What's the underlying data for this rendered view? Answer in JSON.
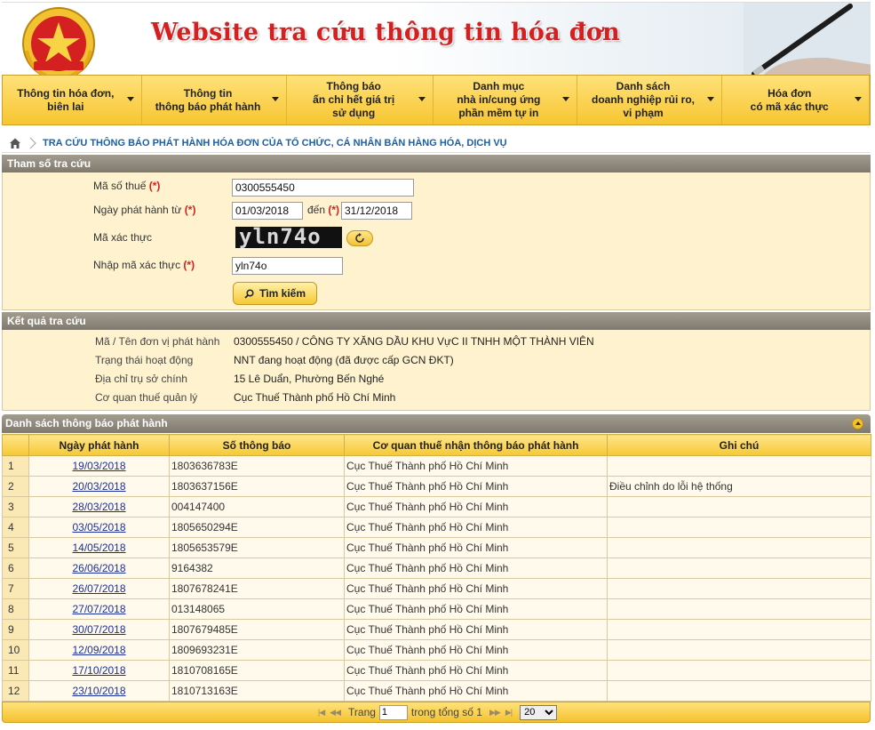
{
  "header": {
    "site_title": "Website tra cứu thông tin hóa đơn",
    "logo_text": "THUẾ NHÀ NƯỚC"
  },
  "menu": [
    {
      "label": "Thông tin hóa đơn,\nbiên lai",
      "width": 157
    },
    {
      "label": "Thông tin\nthông báo phát hành",
      "width": 164
    },
    {
      "label": "Thông báo\nấn chỉ hết giá trị\nsử dụng",
      "width": 165
    },
    {
      "label": "Danh mục\nnhà in/cung ứng\nphần mềm tự in",
      "width": 162
    },
    {
      "label": "Danh sách\ndoanh nghiệp rủi ro,\nvi phạm",
      "width": 164
    },
    {
      "label": "Hóa đơn\ncó mã xác thực",
      "width": 166
    }
  ],
  "breadcrumb": {
    "text": "TRA CỨU THÔNG BÁO PHÁT HÀNH HÓA ĐƠN CỦA TỔ CHỨC, CÁ NHÂN BÁN HÀNG HÓA, DỊCH VỤ"
  },
  "search": {
    "title": "Tham số tra cứu",
    "tax_code_label": "Mã số thuế",
    "tax_code_value": "0300555450",
    "date_label": "Ngày phát hành từ",
    "date_from": "01/03/2018",
    "to_label": "đến",
    "date_to": "31/12/2018",
    "captcha_label": "Mã xác thực",
    "captcha_text": "yln74o",
    "captcha_input_label": "Nhập mã xác thực",
    "captcha_input_value": "yln74o",
    "required_mark": "(*)",
    "search_button": "Tìm kiếm"
  },
  "result": {
    "title": "Kết quả tra cứu",
    "rows": [
      {
        "k": "Mã / Tên đơn vị phát hành",
        "v": "0300555450 / CÔNG TY XĂNG DẦU KHU VựC II TNHH MỘT THÀNH VIÊN"
      },
      {
        "k": "Trạng thái hoạt động",
        "v": "NNT đang hoạt động (đã được cấp GCN ĐKT)"
      },
      {
        "k": "Địa chỉ trụ sở chính",
        "v": "15 Lê Duẩn, Phường Bến Nghé"
      },
      {
        "k": "Cơ quan thuế quản lý",
        "v": "Cục Thuế Thành phố Hồ Chí Minh"
      }
    ]
  },
  "list": {
    "title": "Danh sách thông báo phát hành",
    "columns": [
      "",
      "Ngày phát hành",
      "Số thông báo",
      "Cơ quan thuế nhận thông báo phát hành",
      "Ghi chú"
    ],
    "rows": [
      {
        "idx": "1",
        "date": "19/03/2018",
        "num": "1803636783E",
        "office": "Cục Thuế Thành phố Hồ Chí Minh",
        "note": ""
      },
      {
        "idx": "2",
        "date": "20/03/2018",
        "num": "1803637156E",
        "office": "Cục Thuế Thành phố Hồ Chí Minh",
        "note": "Điều chỉnh do lỗi hệ thống"
      },
      {
        "idx": "3",
        "date": "28/03/2018",
        "num": "004147400",
        "office": "Cục Thuế Thành phố Hồ Chí Minh",
        "note": ""
      },
      {
        "idx": "4",
        "date": "03/05/2018",
        "num": "1805650294E",
        "office": "Cục Thuế Thành phố Hồ Chí Minh",
        "note": ""
      },
      {
        "idx": "5",
        "date": "14/05/2018",
        "num": "1805653579E",
        "office": "Cục Thuế Thành phố Hồ Chí Minh",
        "note": ""
      },
      {
        "idx": "6",
        "date": "26/06/2018",
        "num": "9164382",
        "office": "Cục Thuế Thành phố Hồ Chí Minh",
        "note": ""
      },
      {
        "idx": "7",
        "date": "26/07/2018",
        "num": "1807678241E",
        "office": "Cục Thuế Thành phố Hồ Chí Minh",
        "note": ""
      },
      {
        "idx": "8",
        "date": "27/07/2018",
        "num": "013148065",
        "office": "Cục Thuế Thành phố Hồ Chí Minh",
        "note": ""
      },
      {
        "idx": "9",
        "date": "30/07/2018",
        "num": "1807679485E",
        "office": "Cục Thuế Thành phố Hồ Chí Minh",
        "note": ""
      },
      {
        "idx": "10",
        "date": "12/09/2018",
        "num": "1809693231E",
        "office": "Cục Thuế Thành phố Hồ Chí Minh",
        "note": ""
      },
      {
        "idx": "11",
        "date": "17/10/2018",
        "num": "1810708165E",
        "office": "Cục Thuế Thành phố Hồ Chí Minh",
        "note": ""
      },
      {
        "idx": "12",
        "date": "23/10/2018",
        "num": "1810713163E",
        "office": "Cục Thuế Thành phố Hồ Chí Minh",
        "note": ""
      }
    ]
  },
  "pager": {
    "page_label": "Trang",
    "page_value": "1",
    "total_label": "trong tổng số 1",
    "page_size": "20"
  },
  "colors": {
    "accent_yellow": "#f6c834",
    "title_red": "#d42020",
    "link_blue": "#1a2f9c"
  }
}
